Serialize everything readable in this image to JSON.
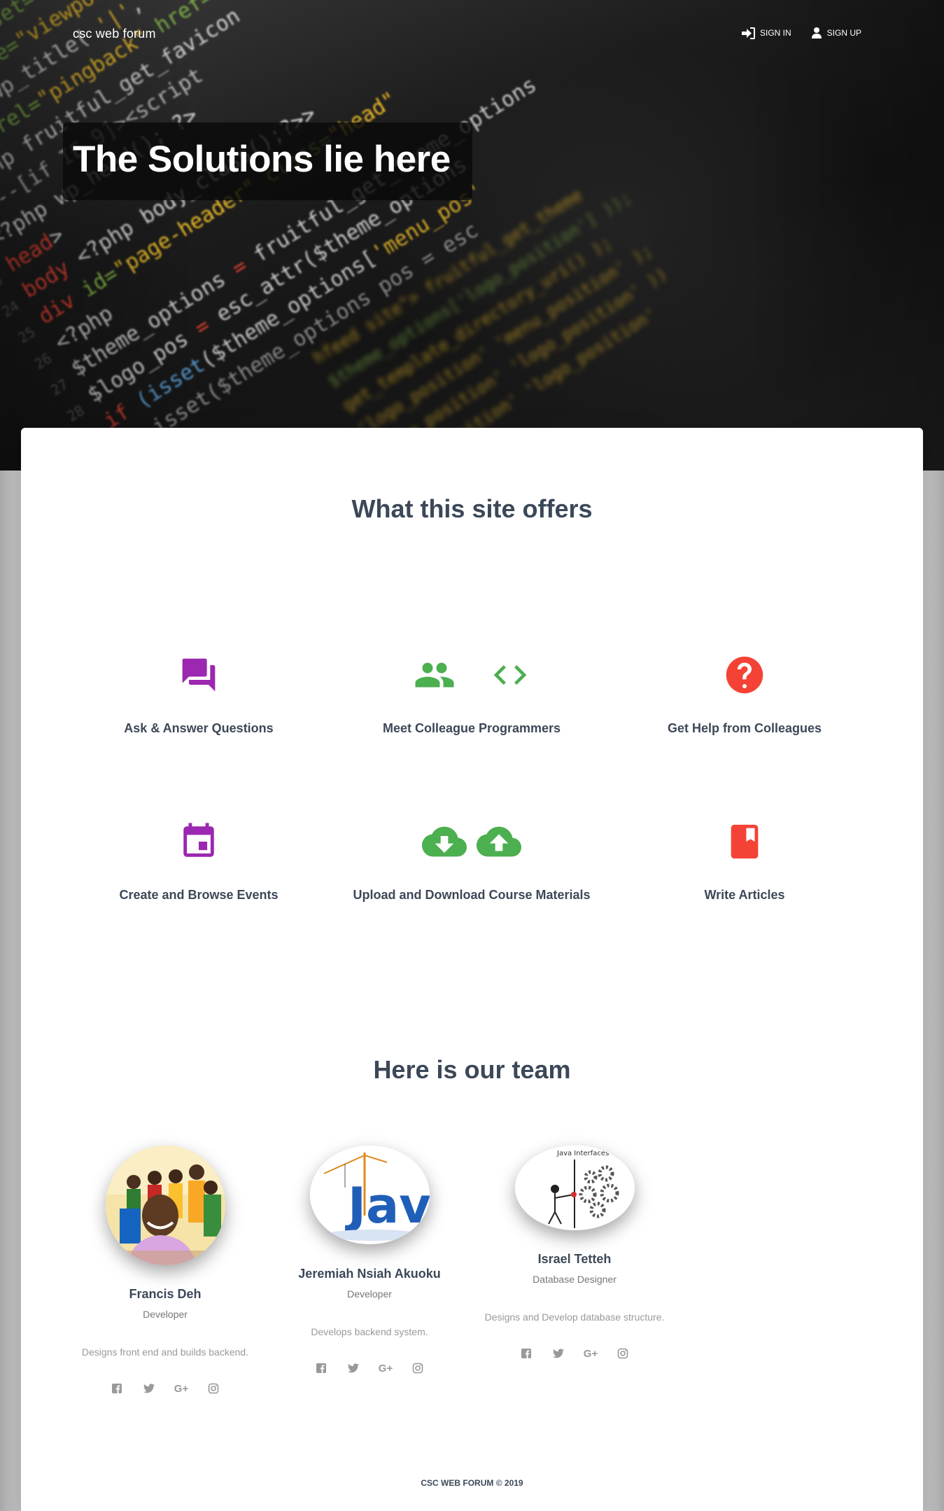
{
  "header": {
    "brand": "csc web forum",
    "nav": [
      {
        "label": "SIGN IN",
        "icon": "sign-in-icon"
      },
      {
        "label": "SIGN UP",
        "icon": "user-icon"
      }
    ]
  },
  "hero": {
    "headline": "The Solutions lie here"
  },
  "offers": {
    "title": "What this site offers",
    "features": [
      {
        "label": "Ask & Answer Questions",
        "icons": [
          "forum-icon"
        ],
        "color": "#9c27b0"
      },
      {
        "label": "Meet Colleague Programmers",
        "icons": [
          "people-icon",
          "code-icon"
        ],
        "color": "#4caf50"
      },
      {
        "label": "Get Help from Colleagues",
        "icons": [
          "help-icon"
        ],
        "color": "#f44336"
      },
      {
        "label": "Create and Browse Events",
        "icons": [
          "calendar-icon"
        ],
        "color": "#9c27b0"
      },
      {
        "label": "Upload and Download Course Materials",
        "icons": [
          "cloud-download-icon",
          "cloud-upload-icon"
        ],
        "color": "#4caf50"
      },
      {
        "label": "Write Articles",
        "icons": [
          "book-icon"
        ],
        "color": "#f44336"
      }
    ]
  },
  "team": {
    "title": "Here is our team",
    "members": [
      {
        "name": "Francis Deh",
        "role": "Developer",
        "description": "Designs front end and builds backend."
      },
      {
        "name": "Jeremiah Nsiah Akuoku",
        "role": "Developer",
        "description": "Develops backend system."
      },
      {
        "name": "Israel Tetteh",
        "role": "Database Designer",
        "description": "Designs and Develop database structure."
      }
    ],
    "socials": [
      "facebook-icon",
      "twitter-icon",
      "google-plus-icon",
      "instagram-icon"
    ],
    "social_glyphs": {
      "google_plus": "G+"
    },
    "avatar_labels": {
      "java_logo": "Java",
      "interfaces_title": "Java Interfaces"
    }
  },
  "footer": {
    "text": "CSC WEB FORUM © 2019"
  }
}
